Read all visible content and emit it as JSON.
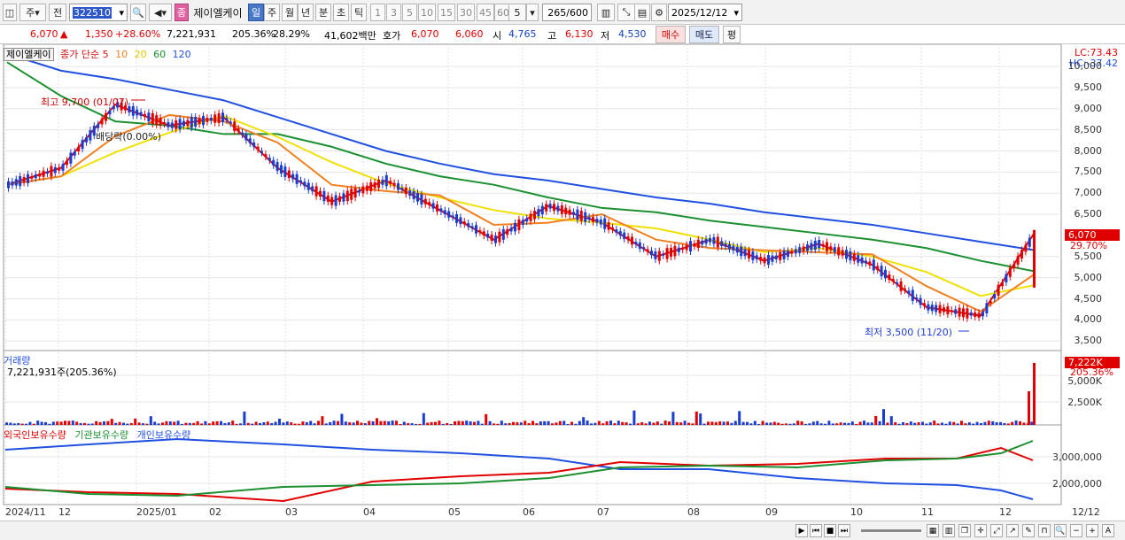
{
  "toolbar": {
    "market_select": "주",
    "prefix": "전",
    "code": "322510",
    "badge": "종",
    "stock_name": "제이엘케이",
    "periods": [
      "일",
      "주",
      "월",
      "년",
      "분",
      "초",
      "틱"
    ],
    "selected_period": "일",
    "minute_options": [
      "1",
      "3",
      "5",
      "10",
      "15",
      "30",
      "45",
      "60"
    ],
    "minute_value": "5",
    "count": "265",
    "count_total": "/600",
    "date": "2025/12/12"
  },
  "quote": {
    "price": "6,070",
    "change_arrow": "▲",
    "change": "1,350",
    "change_pct": "+28.60%",
    "volume": "7,221,931",
    "volume_ratio": "205.36%",
    "turnover": "28.29%",
    "amount": "41,602백만",
    "ask_label": "호가",
    "ask": "6,070",
    "bid": "6,060",
    "open_label": "시",
    "open": "4,765",
    "high_label": "고",
    "high": "6,130",
    "low_label": "저",
    "low": "4,530",
    "buy_label": "매수",
    "sell_label": "매도",
    "eval_label": "평"
  },
  "price_pane": {
    "title": "제이엘케이",
    "ma_label": "종가 단순",
    "ma_periods": [
      "5",
      "10",
      "20",
      "60",
      "120"
    ],
    "high_marker": "최고 9,700 (01/07)",
    "low_marker": "최저 3,500 (11/20)",
    "dividend_marker": "배당락(0.00%)",
    "lc": "LC:73.43",
    "hc": "HC:-37.42",
    "current_tag": "6,070",
    "current_pct": "29.70%",
    "y_ticks": [
      "10,000",
      "9,500",
      "9,000",
      "8,500",
      "8,000",
      "7,500",
      "7,000",
      "6,500",
      "5,500",
      "5,000",
      "4,500",
      "4,000",
      "3,500"
    ]
  },
  "volume_pane": {
    "title": "거래량",
    "value_text": "7,221,931주(205.36%)",
    "tag_value": "7,222K",
    "tag_pct": "205.36%",
    "y_ticks": [
      "5,000K",
      "2,500K"
    ]
  },
  "holding_pane": {
    "legend": [
      "외국인보유수량",
      "기관보유수량",
      "개인보유수량"
    ],
    "y_ticks": [
      "3,000,000",
      "2,000,000"
    ]
  },
  "x_axis": [
    "2024/11",
    "12",
    "2025/01",
    "02",
    "03",
    "04",
    "05",
    "06",
    "07",
    "08",
    "09",
    "10",
    "11",
    "12"
  ],
  "x_axis_right": "12/12",
  "colors": {
    "up": "#e00000",
    "down": "#1a3cd0",
    "ma5": "#d01010",
    "ma10": "#f08020",
    "ma20": "#f0e000",
    "ma60": "#1a9030",
    "ma120": "#2050e0"
  },
  "chart_data": {
    "type": "line",
    "title": "제이엘케이",
    "series": [
      {
        "name": "120",
        "values": [
          10300,
          9900,
          9700,
          9450,
          9200,
          8800,
          8400,
          8000,
          7700,
          7450,
          7300,
          7100,
          6900,
          6750,
          6550,
          6400,
          6250,
          6050,
          5850,
          5650
        ]
      },
      {
        "name": "60",
        "values": [
          10100,
          9300,
          8700,
          8600,
          8400,
          8400,
          8100,
          7700,
          7400,
          7200,
          6900,
          6650,
          6550,
          6350,
          6200,
          6050,
          5900,
          5700,
          5400,
          5150
        ]
      },
      {
        "name": "종가",
        "values": [
          7200,
          7600,
          9100,
          8600,
          8800,
          7600,
          6800,
          7300,
          6600,
          5900,
          6700,
          6300,
          5500,
          5900,
          5400,
          5800,
          5300,
          4300,
          4100,
          6070
        ]
      }
    ],
    "ylim": [
      3400,
      10400
    ]
  }
}
